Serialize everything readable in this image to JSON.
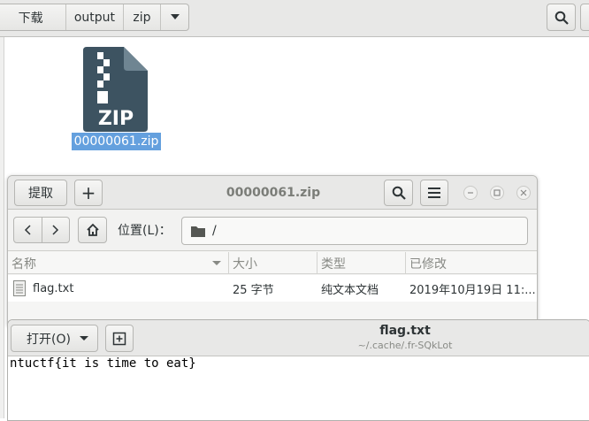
{
  "file_manager": {
    "breadcrumbs": [
      "下载",
      "output",
      "zip"
    ],
    "dropdown_icon": "triangle-down-icon",
    "search_icon": "search-icon",
    "item": {
      "icon_text": "ZIP",
      "filename": "00000061.zip"
    }
  },
  "archive_manager": {
    "extract_label": "提取",
    "add_label": "+",
    "title": "00000061.zip",
    "location_label": "位置(L)：",
    "location_path": "/",
    "columns": [
      "名称",
      "大小",
      "类型",
      "已修改"
    ],
    "rows": [
      {
        "name": "flag.txt",
        "size": "25 字节",
        "type": "纯文本文档",
        "modified": "2019年10月19日 11:..."
      }
    ]
  },
  "text_editor": {
    "open_label": "打开(O)",
    "title": "flag.txt",
    "subtitle": "~/.cache/.fr-SQkLot",
    "content": "ntuctf{it is time to eat}"
  },
  "colors": {
    "selection": "#4a90d9",
    "zip_icon_body": "#3d5361",
    "zip_icon_fold": "#6f8592"
  }
}
